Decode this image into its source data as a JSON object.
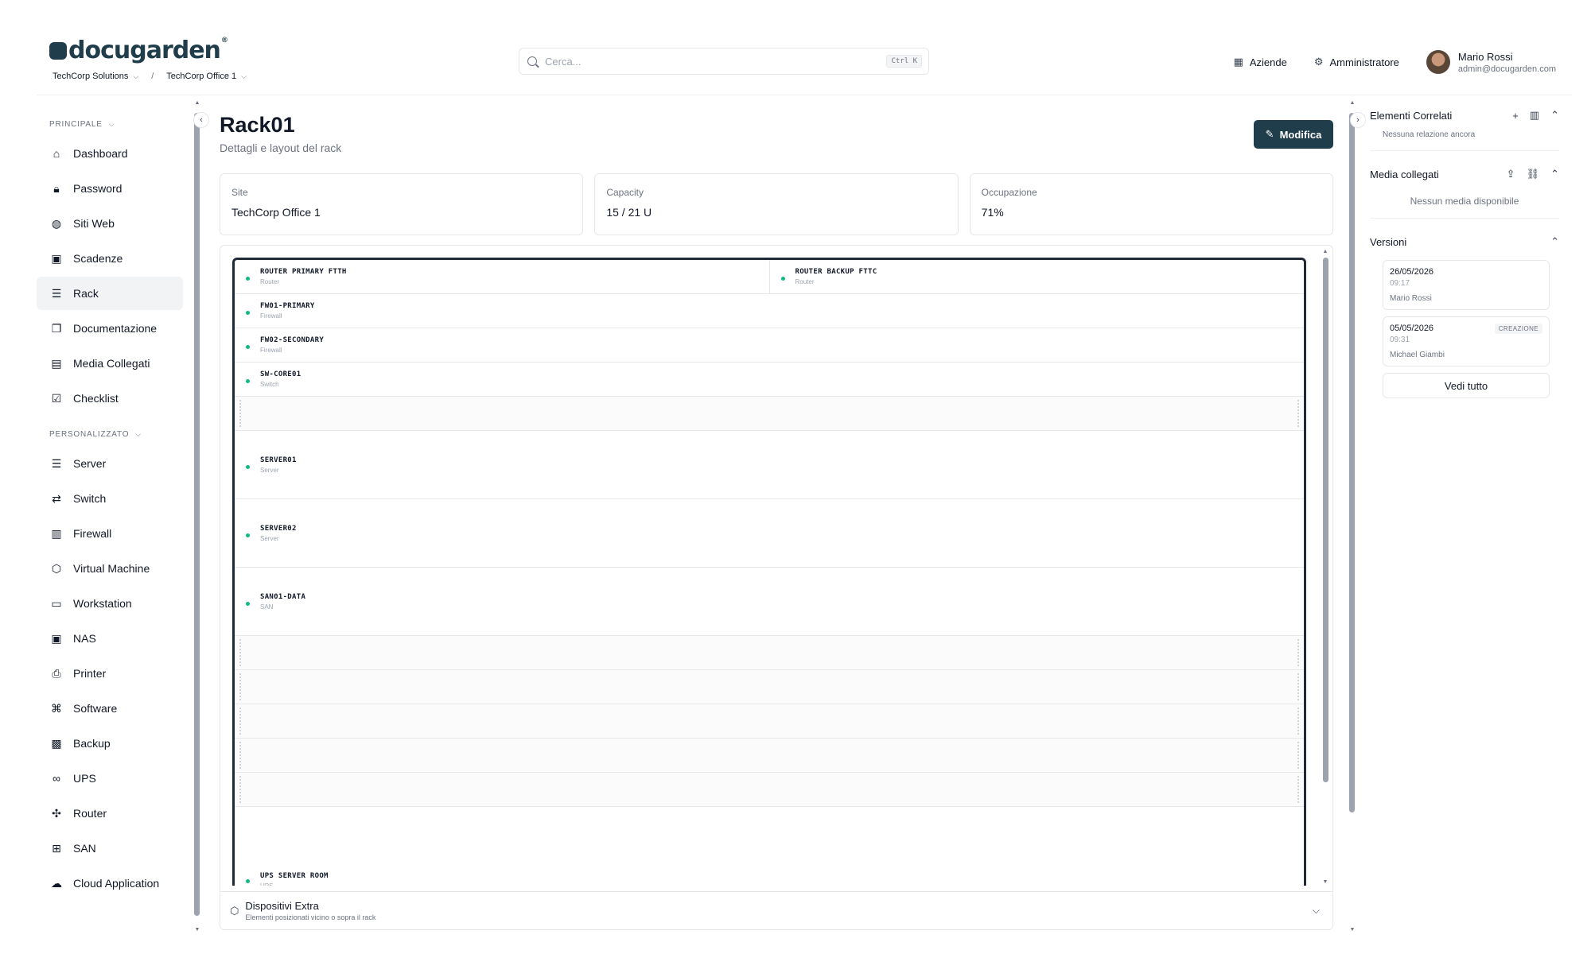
{
  "brand": {
    "name": "docugarden",
    "reg": "®"
  },
  "breadcrumb": {
    "company": "TechCorp Solutions",
    "site": "TechCorp Office 1"
  },
  "search": {
    "placeholder": "Cerca...",
    "shortcut": "Ctrl K"
  },
  "topnav": {
    "companies": "Aziende",
    "admin": "Amministratore"
  },
  "user": {
    "name": "Mario Rossi",
    "email": "admin@docugarden.com"
  },
  "sidebar": {
    "principale_label": "PRINCIPALE",
    "principale": [
      {
        "label": "Dashboard"
      },
      {
        "label": "Password"
      },
      {
        "label": "Siti Web"
      },
      {
        "label": "Scadenze"
      },
      {
        "label": "Rack"
      },
      {
        "label": "Documentazione"
      },
      {
        "label": "Media Collegati"
      },
      {
        "label": "Checklist"
      }
    ],
    "personalizzato_label": "PERSONALIZZATO",
    "personalizzato": [
      {
        "label": "Server"
      },
      {
        "label": "Switch"
      },
      {
        "label": "Firewall"
      },
      {
        "label": "Virtual Machine"
      },
      {
        "label": "Workstation"
      },
      {
        "label": "NAS"
      },
      {
        "label": "Printer"
      },
      {
        "label": "Software"
      },
      {
        "label": "Backup"
      },
      {
        "label": "UPS"
      },
      {
        "label": "Router"
      },
      {
        "label": "SAN"
      },
      {
        "label": "Cloud Application"
      }
    ]
  },
  "page": {
    "title": "Rack01",
    "subtitle": "Dettagli e layout del rack",
    "edit_label": "Modifica"
  },
  "stats": [
    {
      "label": "Site",
      "value": "TechCorp Office 1"
    },
    {
      "label": "Capacity",
      "value": "15 / 21 U"
    },
    {
      "label": "Occupazione",
      "value": "71%"
    }
  ],
  "rack": {
    "devices": {
      "router_primary": {
        "name": "ROUTER PRIMARY FTTH",
        "type": "Router"
      },
      "router_backup": {
        "name": "ROUTER BACKUP FTTC",
        "type": "Router"
      },
      "fw01": {
        "name": "FW01-PRIMARY",
        "type": "Firewall"
      },
      "fw02": {
        "name": "FW02-SECONDARY",
        "type": "Firewall"
      },
      "sw01": {
        "name": "SW-CORE01",
        "type": "Switch"
      },
      "server01": {
        "name": "SERVER01",
        "type": "Server"
      },
      "server02": {
        "name": "SERVER02",
        "type": "Server"
      },
      "san01": {
        "name": "SAN01-DATA",
        "type": "SAN"
      },
      "ups": {
        "name": "UPS SERVER ROOM",
        "type": "UPS"
      }
    }
  },
  "extras": {
    "title": "Dispositivi Extra",
    "subtitle": "Elementi posizionati vicino o sopra il rack"
  },
  "right": {
    "related_title": "Elementi Correlati",
    "related_empty": "Nessuna relazione ancora",
    "media_title": "Media collegati",
    "media_empty": "Nessun media disponibile",
    "versions_title": "Versioni",
    "versions": [
      {
        "date": "26/05/2026",
        "time": "09:17",
        "user": "Mario Rossi",
        "badge": ""
      },
      {
        "date": "05/05/2026",
        "time": "09:31",
        "user": "Michael Giambi",
        "badge": "CREAZIONE"
      }
    ],
    "see_all": "Vedi tutto"
  }
}
